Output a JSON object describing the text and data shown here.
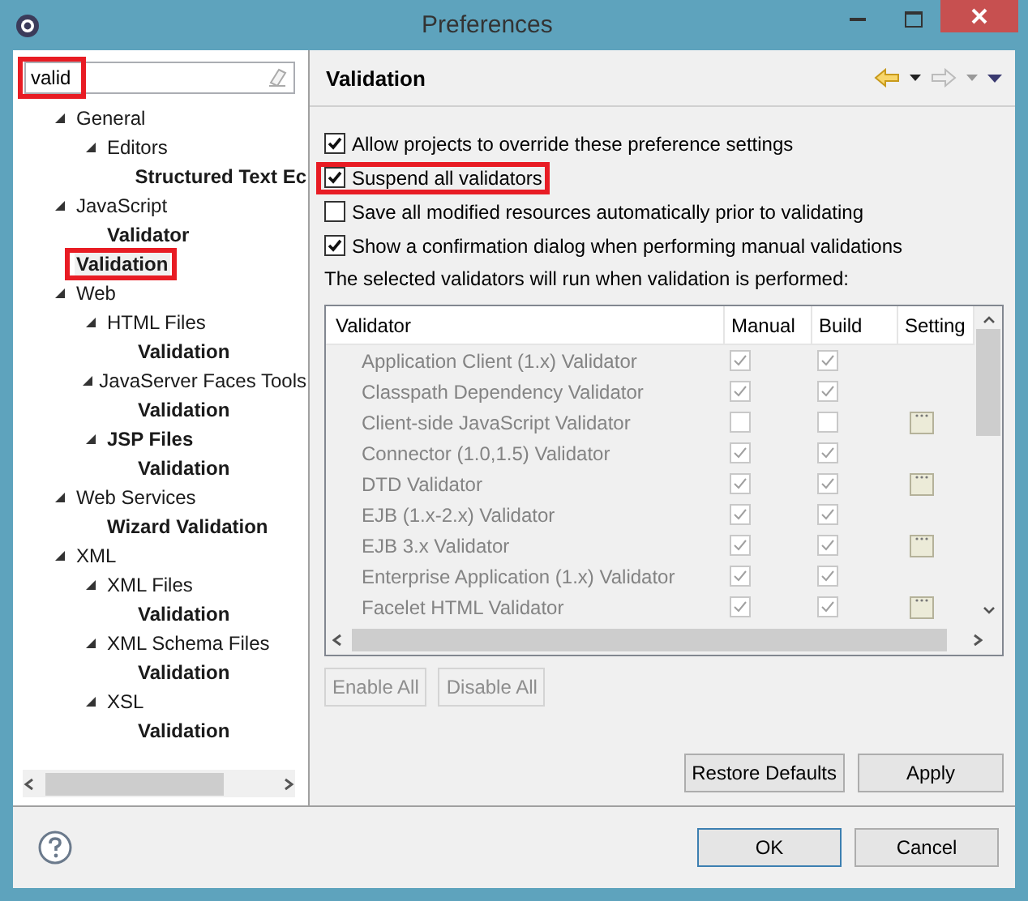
{
  "window": {
    "title": "Preferences"
  },
  "filter": {
    "value": "valid",
    "highlighted": true
  },
  "tree": [
    {
      "label": "General",
      "bold": false,
      "expanded": true,
      "selected": false,
      "children": [
        {
          "label": "Editors",
          "bold": false,
          "expanded": true,
          "selected": false,
          "children": [
            {
              "label": "Structured Text Ec",
              "bold": true,
              "selected": false
            }
          ]
        }
      ]
    },
    {
      "label": "JavaScript",
      "bold": false,
      "expanded": true,
      "selected": false,
      "children": [
        {
          "label": "Validator",
          "bold": true,
          "selected": false
        }
      ]
    },
    {
      "label": "Validation",
      "bold": true,
      "selected": true,
      "highlighted": true
    },
    {
      "label": "Web",
      "bold": false,
      "expanded": true,
      "selected": false,
      "children": [
        {
          "label": "HTML Files",
          "bold": false,
          "expanded": true,
          "selected": false,
          "children": [
            {
              "label": "Validation",
              "bold": true,
              "selected": false
            }
          ]
        },
        {
          "label": "JavaServer Faces Tools",
          "bold": false,
          "expanded": true,
          "selected": false,
          "children": [
            {
              "label": "Validation",
              "bold": true,
              "selected": false
            }
          ]
        },
        {
          "label": "JSP Files",
          "bold": true,
          "expanded": true,
          "selected": false,
          "children": [
            {
              "label": "Validation",
              "bold": true,
              "selected": false
            }
          ]
        }
      ]
    },
    {
      "label": "Web Services",
      "bold": false,
      "expanded": true,
      "selected": false,
      "children": [
        {
          "label": "Wizard Validation",
          "bold": true,
          "selected": false
        }
      ]
    },
    {
      "label": "XML",
      "bold": false,
      "expanded": true,
      "selected": false,
      "children": [
        {
          "label": "XML Files",
          "bold": false,
          "expanded": true,
          "selected": false,
          "children": [
            {
              "label": "Validation",
              "bold": true,
              "selected": false
            }
          ]
        },
        {
          "label": "XML Schema Files",
          "bold": false,
          "expanded": true,
          "selected": false,
          "children": [
            {
              "label": "Validation",
              "bold": true,
              "selected": false
            }
          ]
        },
        {
          "label": "XSL",
          "bold": false,
          "expanded": true,
          "selected": false,
          "children": [
            {
              "label": "Validation",
              "bold": true,
              "selected": false
            }
          ]
        }
      ]
    }
  ],
  "page": {
    "title": "Validation",
    "options": [
      {
        "label": "Allow projects to override these preference settings",
        "checked": true
      },
      {
        "label": "Suspend all validators",
        "checked": true,
        "highlighted": true
      },
      {
        "label": "Save all modified resources automatically prior to validating",
        "checked": false
      },
      {
        "label": "Show a confirmation dialog when performing manual validations",
        "checked": true
      }
    ],
    "note": "The selected validators will run when validation is performed:",
    "table": {
      "disabled": true,
      "columns": [
        "Validator",
        "Manual",
        "Build",
        "Setting"
      ],
      "rows": [
        {
          "name": "Application Client (1.x) Validator",
          "manual": true,
          "build": true,
          "settings": false
        },
        {
          "name": "Classpath Dependency Validator",
          "manual": true,
          "build": true,
          "settings": false
        },
        {
          "name": "Client-side JavaScript Validator",
          "manual": false,
          "build": false,
          "settings": true
        },
        {
          "name": "Connector (1.0,1.5) Validator",
          "manual": true,
          "build": true,
          "settings": false
        },
        {
          "name": "DTD Validator",
          "manual": true,
          "build": true,
          "settings": true
        },
        {
          "name": "EJB (1.x-2.x) Validator",
          "manual": true,
          "build": true,
          "settings": false
        },
        {
          "name": "EJB 3.x Validator",
          "manual": true,
          "build": true,
          "settings": true
        },
        {
          "name": "Enterprise Application (1.x) Validator",
          "manual": true,
          "build": true,
          "settings": false
        },
        {
          "name": "Facelet HTML Validator",
          "manual": true,
          "build": true,
          "settings": true
        }
      ]
    },
    "table_buttons": [
      {
        "label": "Enable All",
        "disabled": true
      },
      {
        "label": "Disable All",
        "disabled": true
      }
    ],
    "buttons": [
      {
        "label": "Restore Defaults",
        "disabled": false
      },
      {
        "label": "Apply",
        "disabled": false
      }
    ]
  },
  "dialog_buttons": [
    {
      "label": "OK",
      "default": true
    },
    {
      "label": "Cancel",
      "default": false
    }
  ]
}
